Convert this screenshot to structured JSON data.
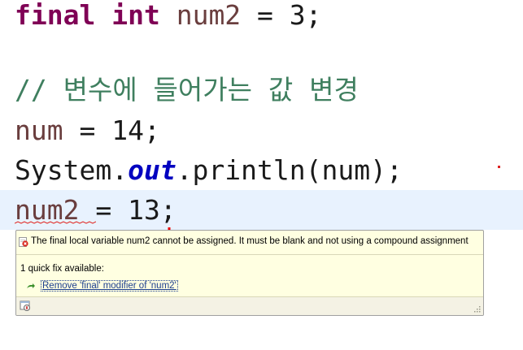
{
  "editor": {
    "line1": {
      "kw1": "final",
      "kw2": "int",
      "rest_var": "num2",
      "rest": " = 3;"
    },
    "line3": {
      "comment": "// 변수에 들어가는 값 변경"
    },
    "line4": {
      "var": "num",
      "rest": " = 14;"
    },
    "line5": {
      "prefix": "System.",
      "field": "out",
      "suffix": ".println(num);"
    },
    "line6": {
      "var": "num2",
      "rest": " = 13;"
    }
  },
  "quickfix": {
    "message": "The final local variable num2 cannot be assigned. It must be blank and not using a compound assignment",
    "count_label": "1 quick fix available:",
    "fix_label": "Remove 'final' modifier of 'num2'"
  },
  "icons": {
    "error": "error-icon",
    "fix": "quickfix-arrow-icon",
    "focus": "focus-popup-icon",
    "grip": "resize-grip-icon"
  },
  "colors": {
    "keyword": "#7f0055",
    "comment": "#3f7f5f",
    "static_field": "#0000c0",
    "local_var": "#6a3e3e",
    "current_line": "#e8f2fe",
    "popup_bg": "#ffffe1"
  }
}
